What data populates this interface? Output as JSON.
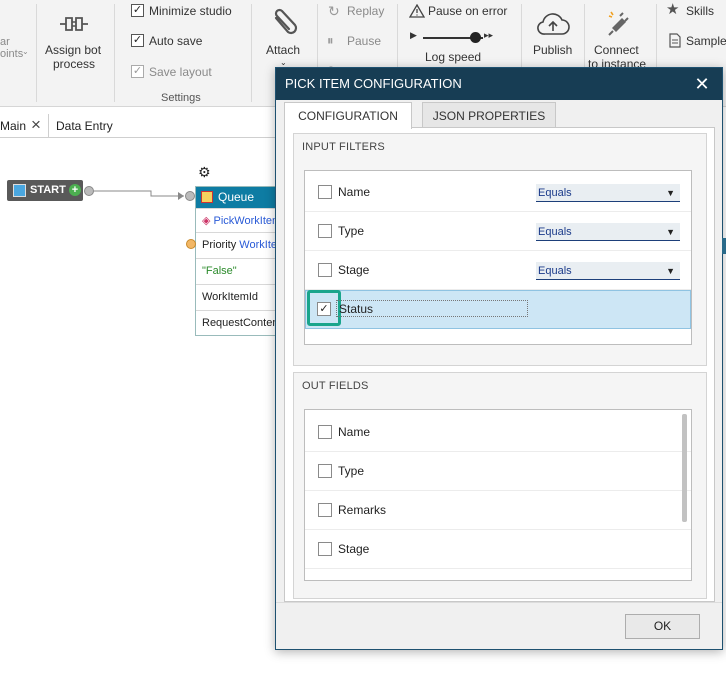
{
  "ribbon": {
    "left_partial": [
      "ar",
      "oints"
    ],
    "assign_bot": [
      "Assign bot",
      "process"
    ],
    "settings": {
      "minimize_studio": "Minimize studio",
      "auto_save": "Auto save",
      "save_layout": "Save layout",
      "group_label": "Settings"
    },
    "attach": "Attach",
    "replay": "Replay",
    "pause": "Pause",
    "pause_on_error": "Pause on error",
    "log_speed": "Log speed",
    "publish": "Publish",
    "connect": [
      "Connect",
      "to instance"
    ],
    "skills": "Skills",
    "samples": "Sample"
  },
  "tabs": {
    "main": "Main",
    "close_glyph": "×",
    "data_entry": "Data Entry"
  },
  "canvas": {
    "start_label": "START",
    "queue_title": "Queue",
    "rows": [
      "PickWorkIten",
      "Priority",
      "WorkIte",
      "\"False\"",
      "WorkItemId",
      "RequestContent"
    ]
  },
  "dialog": {
    "title": "PICK ITEM CONFIGURATION",
    "close_glyph": "✕",
    "tabs": [
      "CONFIGURATION",
      "JSON PROPERTIES"
    ],
    "input_filters": {
      "title": "INPUT FILTERS",
      "rows": [
        {
          "label": "Name",
          "checked": false,
          "operator": "Equals"
        },
        {
          "label": "Type",
          "checked": false,
          "operator": "Equals"
        },
        {
          "label": "Stage",
          "checked": false,
          "operator": "Equals"
        },
        {
          "label": "Status",
          "checked": true,
          "operator": ""
        }
      ]
    },
    "out_fields": {
      "title": "OUT FIELDS",
      "rows": [
        {
          "label": "Name",
          "checked": false
        },
        {
          "label": "Type",
          "checked": false
        },
        {
          "label": "Remarks",
          "checked": false
        },
        {
          "label": "Stage",
          "checked": false
        }
      ]
    },
    "ok": "OK"
  },
  "colors": {
    "dialog_header": "#173d54",
    "selected_row": "#cde6f5",
    "highlight": "#1aa58c"
  }
}
